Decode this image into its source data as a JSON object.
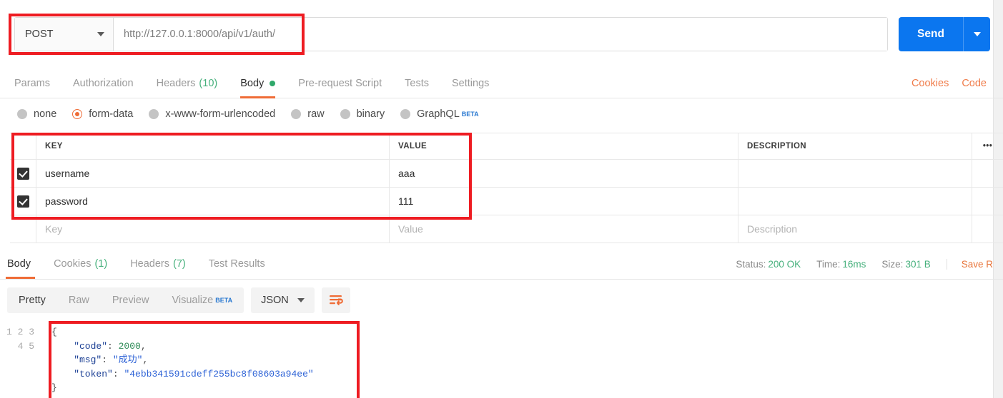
{
  "request": {
    "method": "POST",
    "url": "http://127.0.0.1:8000/api/v1/auth/",
    "send_label": "Send",
    "tabs": [
      {
        "label": "Params",
        "count": "",
        "active": false,
        "dot": false
      },
      {
        "label": "Authorization",
        "count": "",
        "active": false,
        "dot": false
      },
      {
        "label": "Headers",
        "count": "(10)",
        "active": false,
        "dot": false
      },
      {
        "label": "Body",
        "count": "",
        "active": true,
        "dot": true
      },
      {
        "label": "Pre-request Script",
        "count": "",
        "active": false,
        "dot": false
      },
      {
        "label": "Tests",
        "count": "",
        "active": false,
        "dot": false
      },
      {
        "label": "Settings",
        "count": "",
        "active": false,
        "dot": false
      }
    ],
    "tabs_right": [
      {
        "label": "Cookies"
      },
      {
        "label": "Code"
      }
    ],
    "body_types": [
      {
        "label": "none",
        "selected": false,
        "beta": ""
      },
      {
        "label": "form-data",
        "selected": true,
        "beta": ""
      },
      {
        "label": "x-www-form-urlencoded",
        "selected": false,
        "beta": ""
      },
      {
        "label": "raw",
        "selected": false,
        "beta": ""
      },
      {
        "label": "binary",
        "selected": false,
        "beta": ""
      },
      {
        "label": "GraphQL",
        "selected": false,
        "beta": "BETA"
      }
    ],
    "table": {
      "headers": {
        "key": "KEY",
        "value": "VALUE",
        "description": "DESCRIPTION",
        "more": "•••"
      },
      "rows": [
        {
          "checked": true,
          "key": "username",
          "value": "aaa",
          "description": ""
        },
        {
          "checked": true,
          "key": "password",
          "value": "111",
          "description": ""
        }
      ],
      "placeholders": {
        "key": "Key",
        "value": "Value",
        "description": "Description"
      }
    }
  },
  "response": {
    "tabs": [
      {
        "label": "Body",
        "count": "",
        "active": true
      },
      {
        "label": "Cookies",
        "count": "(1)",
        "active": false
      },
      {
        "label": "Headers",
        "count": "(7)",
        "active": false
      },
      {
        "label": "Test Results",
        "count": "",
        "active": false
      }
    ],
    "status": {
      "status_label": "Status:",
      "status_value": "200 OK",
      "time_label": "Time:",
      "time_value": "16ms",
      "size_label": "Size:",
      "size_value": "301 B",
      "save_label": "Save R"
    },
    "viewer": {
      "segments": [
        {
          "label": "Pretty",
          "active": true,
          "beta": ""
        },
        {
          "label": "Raw",
          "active": false,
          "beta": ""
        },
        {
          "label": "Preview",
          "active": false,
          "beta": ""
        },
        {
          "label": "Visualize",
          "active": false,
          "beta": "BETA"
        }
      ],
      "format": "JSON"
    },
    "line_numbers": "1\n2\n3\n4\n5",
    "json": {
      "open_brace": "{",
      "line_code_key": "    \"code\"",
      "line_code_val": "2000",
      "line_msg_key": "    \"msg\"",
      "line_msg_val": "\"成功\"",
      "line_token_key": "    \"token\"",
      "line_token_val": "\"4ebb341591cdeff255bc8f08603a94ee\"",
      "close_brace": "}",
      "colon": ": ",
      "comma": ","
    }
  },
  "colors": {
    "accent_orange": "#ef6c36",
    "send_blue": "#0b76ef",
    "status_green": "#46b07c",
    "annotation_red": "#ee1c22"
  }
}
